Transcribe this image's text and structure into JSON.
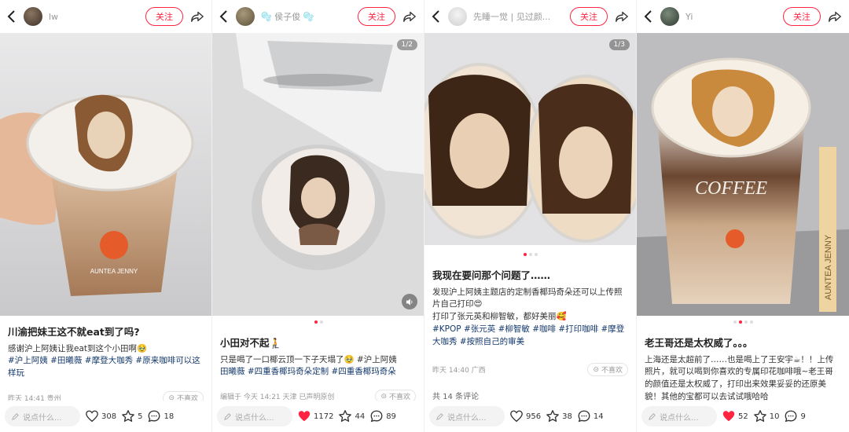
{
  "panels": [
    {
      "author": "lw",
      "follow_label": "关注",
      "title": "川渝把妹王这不就eat到了吗?",
      "body": "感谢沪上阿姨让我eat到这个小田啊🥹",
      "tags": "#沪上阿姨 #田曦薇 #摩登大咖秀 #原来咖啡可以这样玩",
      "meta": "昨天 14:41 贵州",
      "dislike": "不喜欢",
      "input_placeholder": "说点什么...",
      "likes": "308",
      "stars": "5",
      "comments": "18",
      "liked": false
    },
    {
      "author": "🫧 侯子俊 🫧",
      "follow_label": "关注",
      "pager": "1/2",
      "title": "小田对不起🧎",
      "body": "只是喝了一口椰云顶一下子天塌了🥹 #沪上阿姨",
      "tags": "田曦薇 #四重香椰玛奇朵定制 #四重香椰玛奇朵",
      "meta": "编辑于 今天 14:21 天津 已声明原创",
      "dislike": "不喜欢",
      "input_placeholder": "说点什么...",
      "likes": "1172",
      "stars": "44",
      "comments": "89",
      "liked": true
    },
    {
      "author": "先睡一觉 | 见过颜...",
      "follow_label": "关注",
      "pager": "1/3",
      "title": "我现在要问那个问题了……",
      "body": "发现沪上阿姨主题店的定制香椰玛奇朵还可以上传照片自己打印😍\n打印了张元英和柳智敏，都好美丽🥰",
      "tags": "#KPOP #张元英 #柳智敏 #咖啡 #打印咖啡 #摩登大咖秀 #按照自己的审美",
      "meta": "昨天 14:40 广西",
      "dislike": "不喜欢",
      "comments_head": "共 14 条评论",
      "input_placeholder": "说点什么...",
      "likes": "956",
      "stars": "38",
      "comments": "14",
      "liked": false
    },
    {
      "author": "Yi",
      "follow_label": "关注",
      "title": "老王哥还是太权威了。。。",
      "body": "上海还是太超前了……也是喝上了王安宇☕！！上传照片，就可以喝到你喜欢的专属印花咖啡哦~老王哥的颜值还是太权威了，打印出来效果妥妥的还原美貌！其他的宝都可以去试试哦哈哈",
      "tags": "",
      "meta": "",
      "dislike": "",
      "input_placeholder": "说点什么...",
      "likes": "52",
      "stars": "10",
      "comments": "9",
      "liked": true
    }
  ],
  "colors": {
    "accent": "#ff2442",
    "tag": "#13386c"
  },
  "brand_cup_text": "COFFEE",
  "brand_straw_text": "AUNTEA JENNY"
}
